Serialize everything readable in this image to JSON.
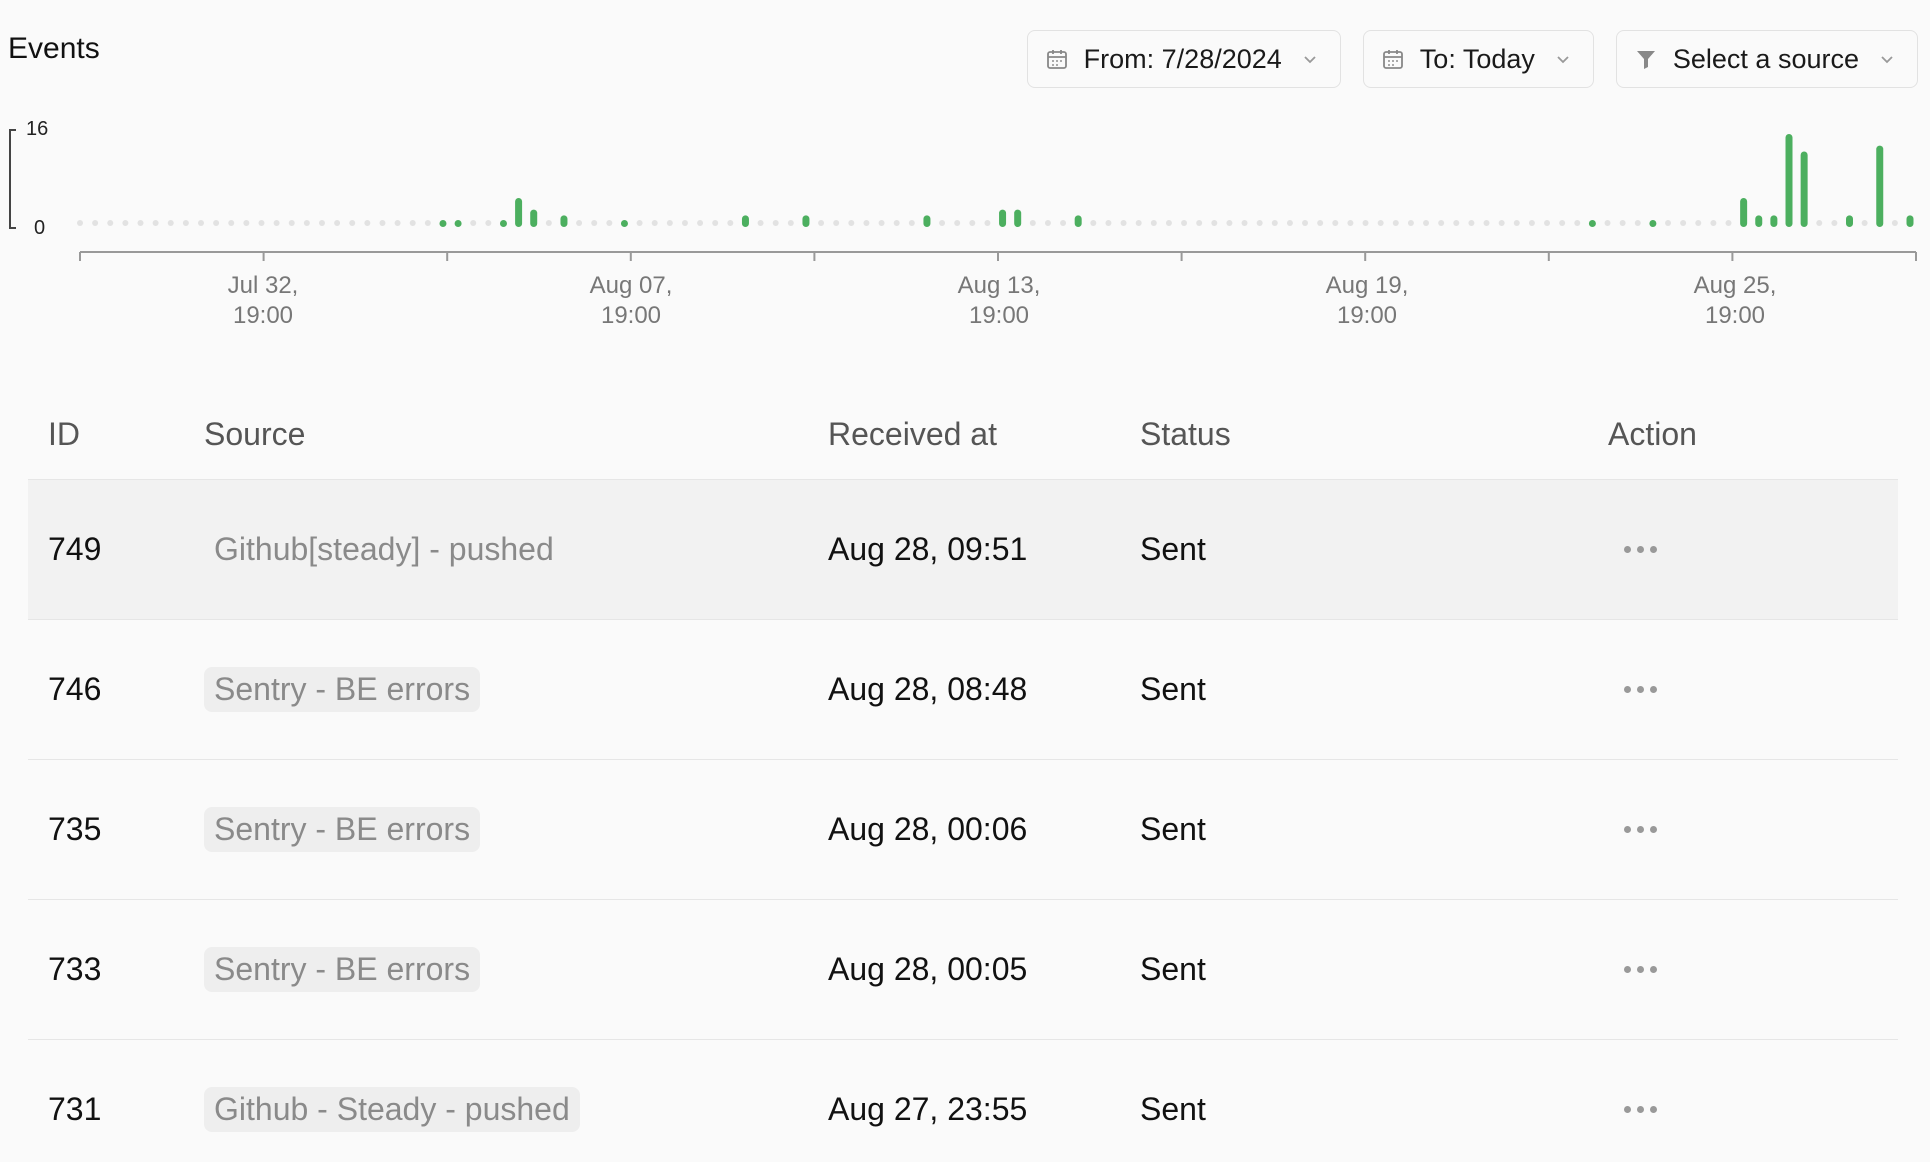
{
  "header": {
    "title": "Events",
    "from_label": "From: 7/28/2024",
    "to_label": "To: Today",
    "source_label": "Select a source"
  },
  "chart_data": {
    "type": "bar",
    "y_max_label": "16",
    "y_min_label": "0",
    "ylim": [
      0,
      16
    ],
    "x_tick_labels": [
      [
        "Jul 32,",
        "19:00"
      ],
      [
        "Aug 07,",
        "19:00"
      ],
      [
        "Aug 13,",
        "19:00"
      ],
      [
        "Aug 19,",
        "19:00"
      ],
      [
        "Aug 25,",
        "19:00"
      ]
    ],
    "bar_color": "#4caf5f",
    "empty_dot_color": "#e2e2e2",
    "slots": 122,
    "values": [
      0,
      0,
      0,
      0,
      0,
      0,
      0,
      0,
      0,
      0,
      0,
      0,
      0,
      0,
      0,
      0,
      0,
      0,
      0,
      0,
      0,
      0,
      0,
      0,
      1,
      1,
      0,
      0,
      1,
      5,
      3,
      0,
      2,
      0,
      0,
      0,
      1,
      0,
      0,
      0,
      0,
      0,
      0,
      0,
      0,
      0,
      0,
      0,
      0,
      0,
      0,
      0,
      0,
      0,
      0,
      0,
      0,
      0,
      0,
      0,
      0,
      3,
      3,
      0,
      0,
      0,
      2,
      0,
      0,
      0,
      0,
      0,
      0,
      0,
      0,
      0,
      0,
      0,
      0,
      0,
      0,
      0,
      0,
      0,
      0,
      0,
      0,
      0,
      0,
      0,
      0,
      0,
      0,
      0,
      0,
      0,
      0,
      0,
      0,
      0,
      0,
      0,
      0,
      0,
      0,
      0,
      0,
      0,
      0,
      0,
      0,
      0,
      0,
      0,
      0,
      0,
      0,
      0,
      0,
      0,
      0,
      0
    ],
    "extra_bars": [
      {
        "slot": 44,
        "value": 2
      },
      {
        "slot": 48,
        "value": 2
      },
      {
        "slot": 56,
        "value": 2
      },
      {
        "slot": 100,
        "value": 1
      },
      {
        "slot": 104,
        "value": 1
      },
      {
        "slot": 110,
        "value": 5
      },
      {
        "slot": 111,
        "value": 2
      },
      {
        "slot": 112,
        "value": 2
      },
      {
        "slot": 113,
        "value": 16
      },
      {
        "slot": 114,
        "value": 13
      },
      {
        "slot": 117,
        "value": 2
      },
      {
        "slot": 119,
        "value": 14
      },
      {
        "slot": 121,
        "value": 2
      }
    ]
  },
  "table": {
    "headers": {
      "id": "ID",
      "source": "Source",
      "received": "Received at",
      "status": "Status",
      "action": "Action"
    },
    "rows": [
      {
        "id": "749",
        "source": "Github[steady] - pushed",
        "received": "Aug 28, 09:51",
        "status": "Sent"
      },
      {
        "id": "746",
        "source": "Sentry - BE errors",
        "received": "Aug 28, 08:48",
        "status": "Sent"
      },
      {
        "id": "735",
        "source": "Sentry - BE errors",
        "received": "Aug 28, 00:06",
        "status": "Sent"
      },
      {
        "id": "733",
        "source": "Sentry - BE errors",
        "received": "Aug 28, 00:05",
        "status": "Sent"
      },
      {
        "id": "731",
        "source": "Github - Steady - pushed",
        "received": "Aug 27, 23:55",
        "status": "Sent"
      }
    ]
  }
}
